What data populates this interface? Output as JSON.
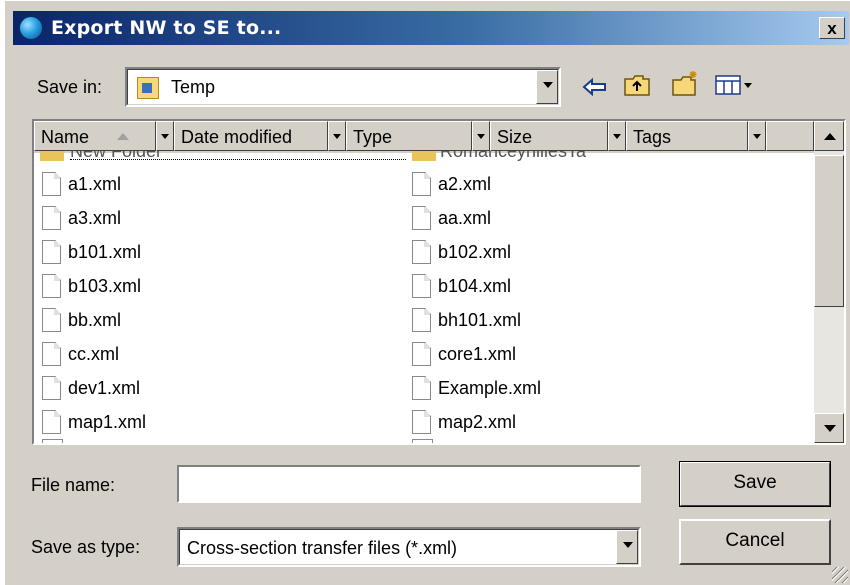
{
  "window": {
    "title": "Export NW to SE to...",
    "close_label": "x"
  },
  "save_in": {
    "label": "Save in:",
    "value": "Temp"
  },
  "toolbar": {
    "icons": [
      "back-arrow-icon",
      "up-folder-icon",
      "new-folder-icon",
      "view-menu-icon"
    ]
  },
  "columns": [
    {
      "label": "Name"
    },
    {
      "label": "Date modified"
    },
    {
      "label": "Type"
    },
    {
      "label": "Size"
    },
    {
      "label": "Tags"
    }
  ],
  "partial_items": [
    "New Folder",
    "RomanceyhillesTa"
  ],
  "files_left": [
    "a1.xml",
    "a3.xml",
    "b101.xml",
    "b103.xml",
    "bb.xml",
    "cc.xml",
    "dev1.xml",
    "map1.xml"
  ],
  "files_right": [
    "a2.xml",
    "aa.xml",
    "b102.xml",
    "b104.xml",
    "bh101.xml",
    "core1.xml",
    "Example.xml",
    "map2.xml"
  ],
  "file_name": {
    "label": "File name:",
    "value": ""
  },
  "save_as_type": {
    "label": "Save as type:",
    "value": "Cross-section transfer files (*.xml)"
  },
  "buttons": {
    "save": "Save",
    "cancel": "Cancel"
  }
}
